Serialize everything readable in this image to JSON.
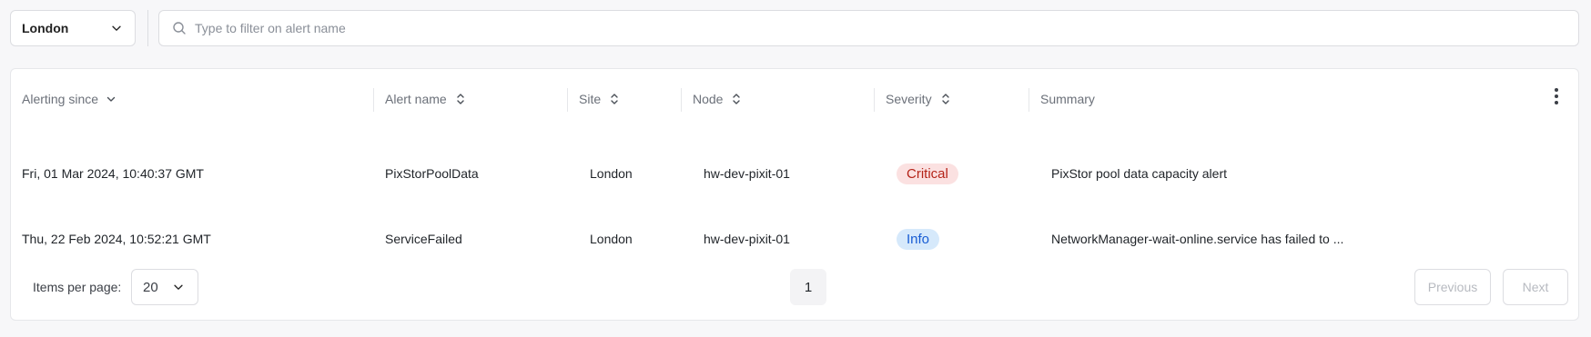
{
  "filters": {
    "site_value": "London",
    "search_placeholder": "Type to filter on alert name",
    "search_value": ""
  },
  "table": {
    "columns": [
      {
        "label": "Alerting since",
        "sort": "desc"
      },
      {
        "label": "Alert name",
        "sort": "both"
      },
      {
        "label": "Site",
        "sort": "both"
      },
      {
        "label": "Node",
        "sort": "both"
      },
      {
        "label": "Severity",
        "sort": "both"
      },
      {
        "label": "Summary",
        "sort": "none"
      }
    ],
    "rows": [
      {
        "alerting_since": "Fri, 01 Mar 2024, 10:40:37 GMT",
        "alert_name": "PixStorPoolData",
        "site": "London",
        "node": "hw-dev-pixit-01",
        "severity": "Critical",
        "summary": "PixStor pool data capacity alert"
      },
      {
        "alerting_since": "Thu, 22 Feb 2024, 10:52:21 GMT",
        "alert_name": "ServiceFailed",
        "site": "London",
        "node": "hw-dev-pixit-01",
        "severity": "Info",
        "summary": "NetworkManager-wait-online.service has failed to ..."
      }
    ]
  },
  "pagination": {
    "items_per_page_label": "Items per page:",
    "items_per_page_value": "20",
    "current_page": "1",
    "previous_label": "Previous",
    "next_label": "Next"
  },
  "icons": {
    "site_dropdown": "chevron-down-icon",
    "search": "search-icon",
    "sort_desc": "chevron-down-icon",
    "sort_both": "sort-icon",
    "column_menu": "more-vertical-icon"
  },
  "colors": {
    "critical_bg": "#fbe1e1",
    "critical_text": "#b42318",
    "info_bg": "#d6e9fb",
    "info_text": "#175cd3"
  }
}
